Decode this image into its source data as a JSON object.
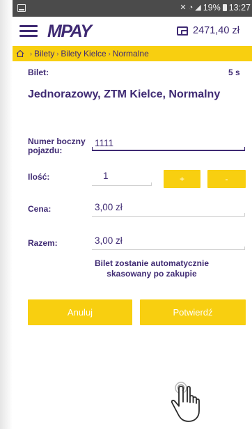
{
  "status_bar": {
    "time": "13:27",
    "battery": "19%"
  },
  "app": {
    "logo": "MPAY",
    "balance": "2471,40 zł"
  },
  "breadcrumb": {
    "items": [
      "Bilety",
      "Bilety Kielce",
      "Normalne"
    ]
  },
  "form": {
    "ticket_label": "Bilet:",
    "timer": "5 s",
    "ticket_name": "Jednorazowy, ZTM Kielce, Normalny",
    "vehicle_label_line1": "Numer boczny",
    "vehicle_label_line2": "pojazdu:",
    "vehicle_value": "1111",
    "quantity_label": "Ilość:",
    "quantity_value": "1",
    "plus_label": "+",
    "minus_label": "-",
    "price_label": "Cena:",
    "price_value": "3,00 zł",
    "total_label": "Razem:",
    "total_value": "3,00 zł",
    "notice_line1": "Bilet zostanie automatycznie",
    "notice_line2": "skasowany po zakupie"
  },
  "actions": {
    "cancel": "Anuluj",
    "confirm": "Potwierdź"
  },
  "colors": {
    "brand": "#3f2a73",
    "accent": "#f8cf10",
    "statusbar": "#4b4b4b"
  },
  "icons": [
    "menu-icon",
    "wallet-icon",
    "home-icon",
    "tap-hand-icon"
  ]
}
